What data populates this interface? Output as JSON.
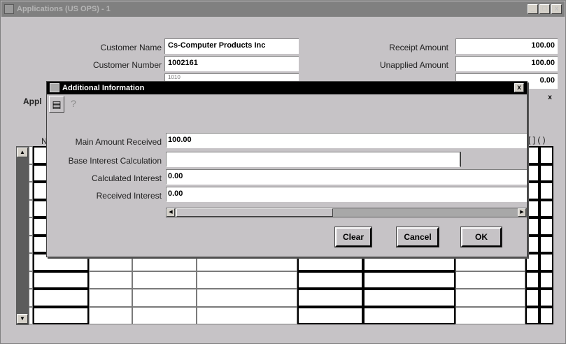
{
  "window": {
    "title": "Applications (US OPS) - 1",
    "controls": [
      "_",
      "□",
      "x"
    ]
  },
  "header": {
    "customer_name_label": "Customer Name",
    "customer_name_value": "Cs-Computer Products Inc",
    "customer_number_label": "Customer Number",
    "customer_number_value": "1002161",
    "partial_value": "1010",
    "receipt_amount_label": "Receipt Amount",
    "receipt_amount_value": "100.00",
    "unapplied_amount_label": "Unapplied Amount",
    "unapplied_amount_value": "100.00",
    "third_amount_value": "0.00",
    "apply_partial_label": "Appl",
    "n_partial_label": "N",
    "checkbox_mark": "x",
    "col_marks_right": "[ ] ( )"
  },
  "dialog": {
    "title": "Additional Information",
    "close": "x",
    "fields": {
      "main_amount_received_label": "Main Amount Received",
      "main_amount_received_value": "100.00",
      "base_interest_calc_label": "Base Interest Calculation",
      "base_interest_calc_value": "",
      "calculated_interest_label": "Calculated Interest",
      "calculated_interest_value": "0.00",
      "received_interest_label": "Received Interest",
      "received_interest_value": "0.00"
    },
    "buttons": {
      "clear": "Clear",
      "cancel": "Cancel",
      "ok": "OK"
    }
  }
}
